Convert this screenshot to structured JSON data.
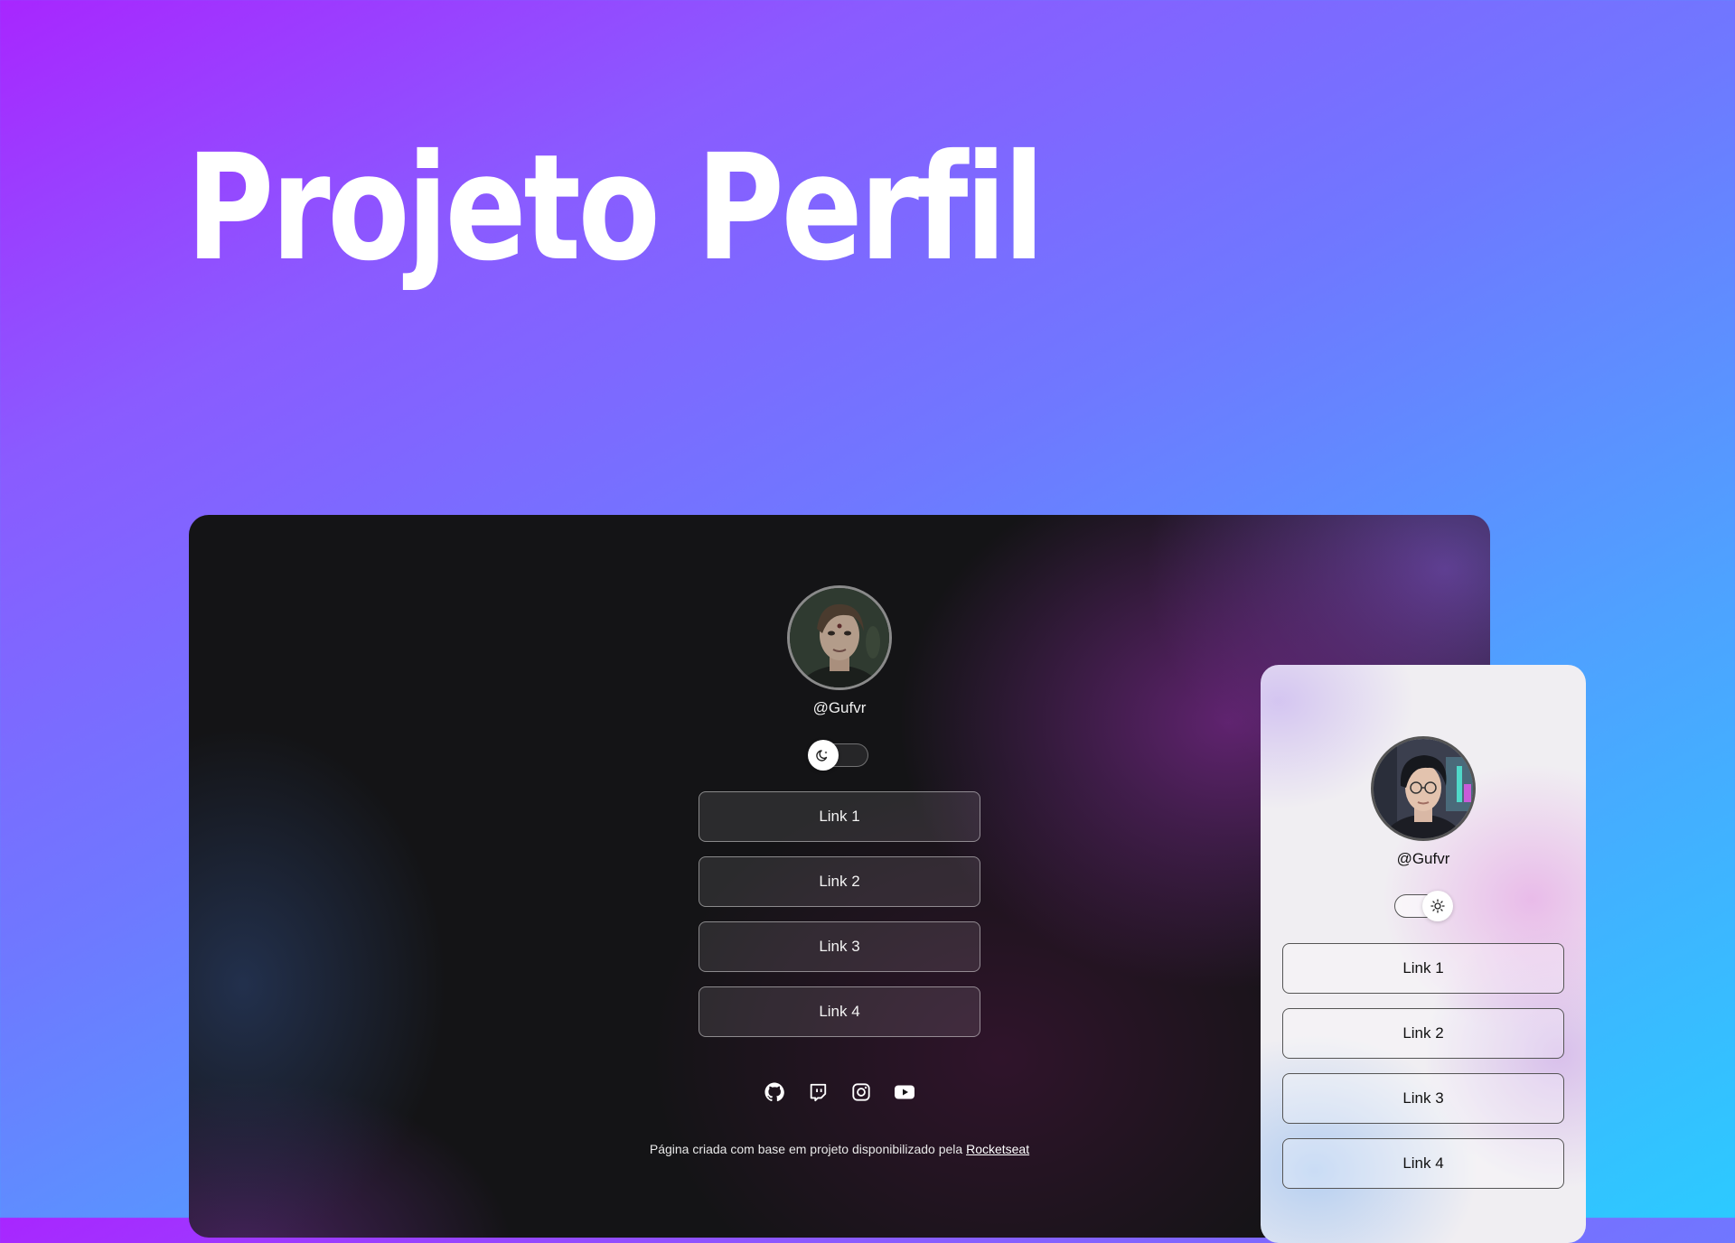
{
  "hero": {
    "title": "Projeto Perfil"
  },
  "dark_preview": {
    "handle": "@Gufvr",
    "theme_toggle": {
      "state": "dark",
      "icon": "moon-icon"
    },
    "links": [
      "Link 1",
      "Link 2",
      "Link 3",
      "Link 4"
    ],
    "social_icons": [
      "github-icon",
      "twitch-icon",
      "instagram-icon",
      "youtube-icon"
    ],
    "footer": {
      "text": "Página criada com base em projeto disponibilizado pela ",
      "link_text": "Rocketseat"
    }
  },
  "light_preview": {
    "handle": "@Gufvr",
    "theme_toggle": {
      "state": "light",
      "icon": "sun-icon"
    },
    "links": [
      "Link 1",
      "Link 2",
      "Link 3",
      "Link 4"
    ]
  }
}
